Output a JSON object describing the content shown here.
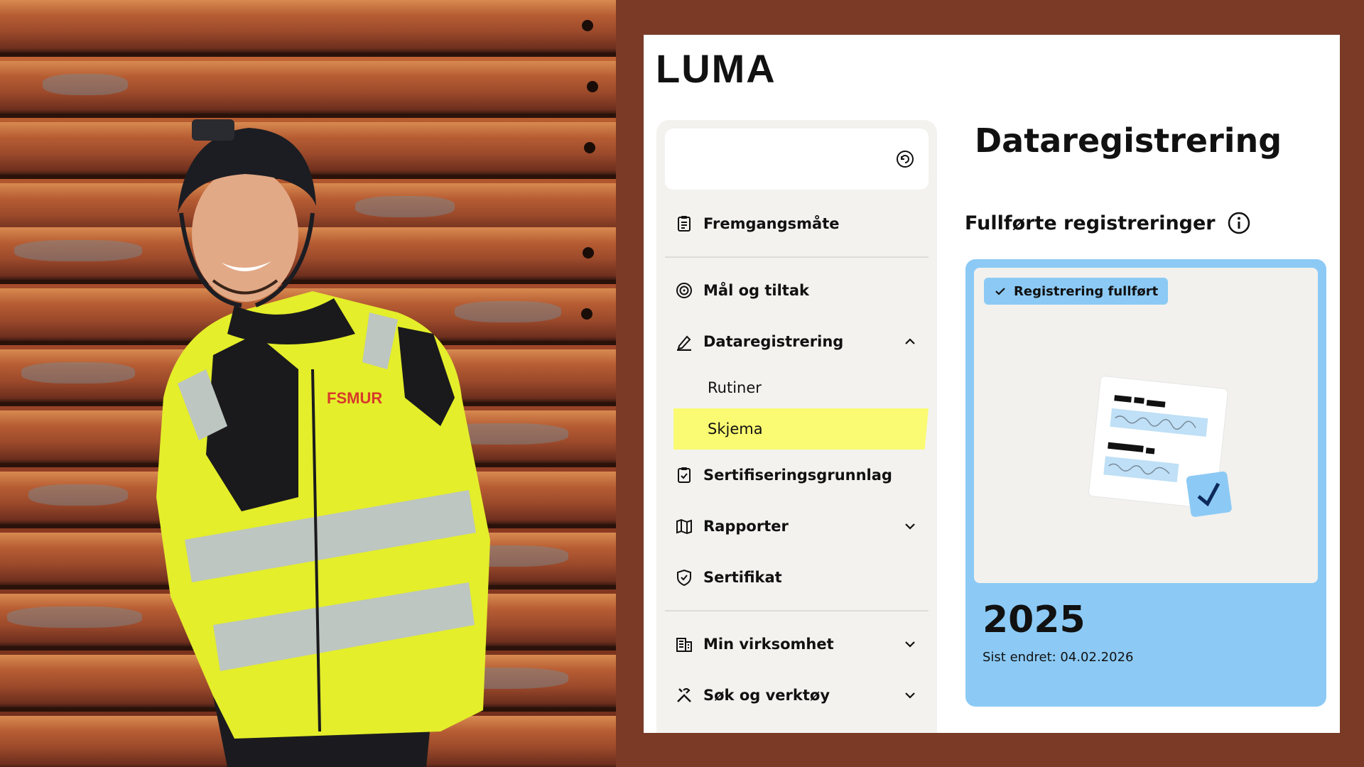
{
  "brand": {
    "logo_text": "LUMA",
    "accent": "#8ccaf5",
    "highlight": "#fafb72",
    "background": "#7a3a26"
  },
  "photo": {
    "jacket_brand": "FSMUR"
  },
  "sidebar": {
    "search_icon": "reset-icon",
    "items": [
      {
        "label": "Fremgangsmåte",
        "icon": "clipboard-icon"
      },
      {
        "label": "Mål og tiltak",
        "icon": "target-icon"
      },
      {
        "label": "Dataregistrering",
        "icon": "pen-icon",
        "expanded": true,
        "children": [
          {
            "label": "Rutiner"
          },
          {
            "label": "Skjema",
            "active": true
          }
        ]
      },
      {
        "label": "Sertifiseringsgrunnlag",
        "icon": "checklist-icon"
      },
      {
        "label": "Rapporter",
        "icon": "map-icon",
        "expandable": true
      },
      {
        "label": "Sertifikat",
        "icon": "shield-icon"
      },
      {
        "label": "Min virksomhet",
        "icon": "building-icon",
        "expandable": true
      },
      {
        "label": "Søk og verktøy",
        "icon": "tools-icon",
        "expandable": true
      }
    ]
  },
  "main": {
    "title": "Dataregistrering",
    "section_title": "Fullførte registreringer",
    "card": {
      "badge": "Registrering fullført",
      "year": "2025",
      "last_modified": "Sist endret: 04.02.2026"
    }
  }
}
